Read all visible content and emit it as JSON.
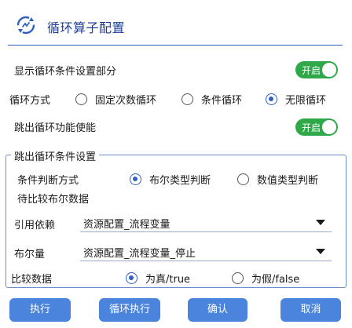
{
  "header": {
    "title": "循环算子配置",
    "logo_icon": "loop-sync-icon"
  },
  "show_section": {
    "label": "显示循环条件设置部分",
    "toggle": "开启"
  },
  "loop_mode": {
    "label": "循环方式",
    "options": [
      "固定次数循环",
      "条件循环",
      "无限循环"
    ],
    "selected": "无限循环"
  },
  "break_enable": {
    "label": "跳出循环功能使能",
    "toggle": "开启"
  },
  "break_group": {
    "title": "跳出循环条件设置",
    "judge_mode": {
      "label": "条件判断方式",
      "options": [
        "布尔类型判断",
        "数值类型判断"
      ],
      "selected": "布尔类型判断"
    },
    "compare_title": "待比较布尔数据",
    "reference": {
      "label": "引用依赖",
      "value": "资源配置_流程变量"
    },
    "bool_var": {
      "label": "布尔量",
      "value": "资源配置_流程变量_停止"
    },
    "compare_data": {
      "label": "比较数据",
      "options": [
        "为真/true",
        "为假/false"
      ],
      "selected": "为真/true"
    }
  },
  "buttons": {
    "execute": "执行",
    "loop_execute": "循环执行",
    "confirm": "确认",
    "cancel": "取消"
  },
  "colors": {
    "accent": "#2f5fbf",
    "toggle_on": "#2fa84a",
    "button": "#4a84dd",
    "title": "#1c3f93"
  }
}
